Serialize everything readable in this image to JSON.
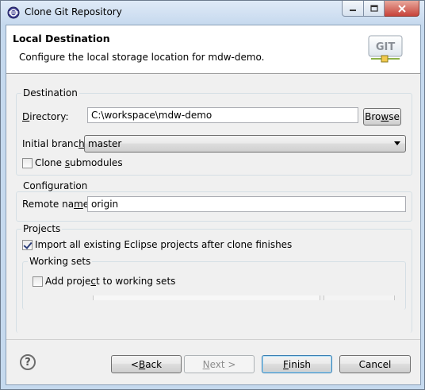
{
  "window": {
    "title": "Clone Git Repository",
    "controls": {
      "minimize": "minimize",
      "maximize": "maximize",
      "close": "close"
    }
  },
  "banner": {
    "title": "Local Destination",
    "description": "Configure the local storage location for mdw-demo.",
    "logo_text": "GIT"
  },
  "destination": {
    "group_title": "Destination",
    "directory_label": "Directory:",
    "directory_value": "C:\\workspace\\mdw-demo",
    "browse_label": "Browse",
    "branch_label": "Initial branch:",
    "branch_value": "master",
    "clone_submodules_label": "Clone submodules",
    "clone_submodules_checked": false
  },
  "configuration": {
    "group_title": "Configuration",
    "remote_label": "Remote name:",
    "remote_value": "origin"
  },
  "projects": {
    "group_title": "Projects",
    "import_label": "Import all existing Eclipse projects after clone finishes",
    "import_checked": true,
    "working_sets": {
      "group_title": "Working sets",
      "add_label": "Add project to working sets",
      "add_checked": false
    }
  },
  "footer": {
    "help_symbol": "?",
    "back_label": "< Back",
    "next_label": "Next >",
    "finish_label": "Finish",
    "cancel_label": "Cancel"
  }
}
